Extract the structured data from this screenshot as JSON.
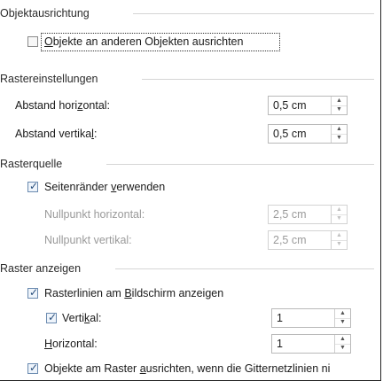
{
  "sections": {
    "objektausrichtung": "Objektausrichtung",
    "rastereinstellungen": "Rastereinstellungen",
    "rasterquelle": "Rasterquelle",
    "raster_anzeigen": "Raster anzeigen"
  },
  "snap_to_objects": {
    "checked": false,
    "pre": "",
    "mnemonic": "O",
    "post": "bjekte an anderen Objekten ausrichten"
  },
  "spacing": {
    "horizontal": {
      "pre": "Abstand hori",
      "mnemonic": "z",
      "post": "ontal:",
      "value": "0,5 cm"
    },
    "vertical": {
      "pre": "Abstand vertika",
      "mnemonic": "l",
      "post": ":",
      "value": "0,5 cm"
    }
  },
  "grid_source": {
    "use_margins": {
      "checked": true,
      "pre": "Seitenränder ",
      "mnemonic": "v",
      "post": "erwenden"
    },
    "origin_horizontal": {
      "label": "Nullpunkt horizontal:",
      "value": "2,5 cm"
    },
    "origin_vertical": {
      "label": "Nullpunkt vertikal:",
      "value": "2,5 cm"
    }
  },
  "show_grid": {
    "gridlines": {
      "checked": true,
      "pre": "Rasterlinien am ",
      "mnemonic": "B",
      "post": "ildschirm anzeigen"
    },
    "vertical": {
      "checked": true,
      "pre": "Verti",
      "mnemonic": "k",
      "post": "al:",
      "value": "1"
    },
    "horizontal": {
      "pre": "",
      "mnemonic": "H",
      "post": "orizontal:",
      "value": "1"
    },
    "snap_when_hidden": {
      "checked": true,
      "pre": "Objekte am Raster ",
      "mnemonic": "a",
      "post": "usrichten, wenn die Gitternetzlinien ni"
    }
  },
  "glyphs": {
    "check": "✓",
    "up": "▲",
    "down": "▼"
  }
}
